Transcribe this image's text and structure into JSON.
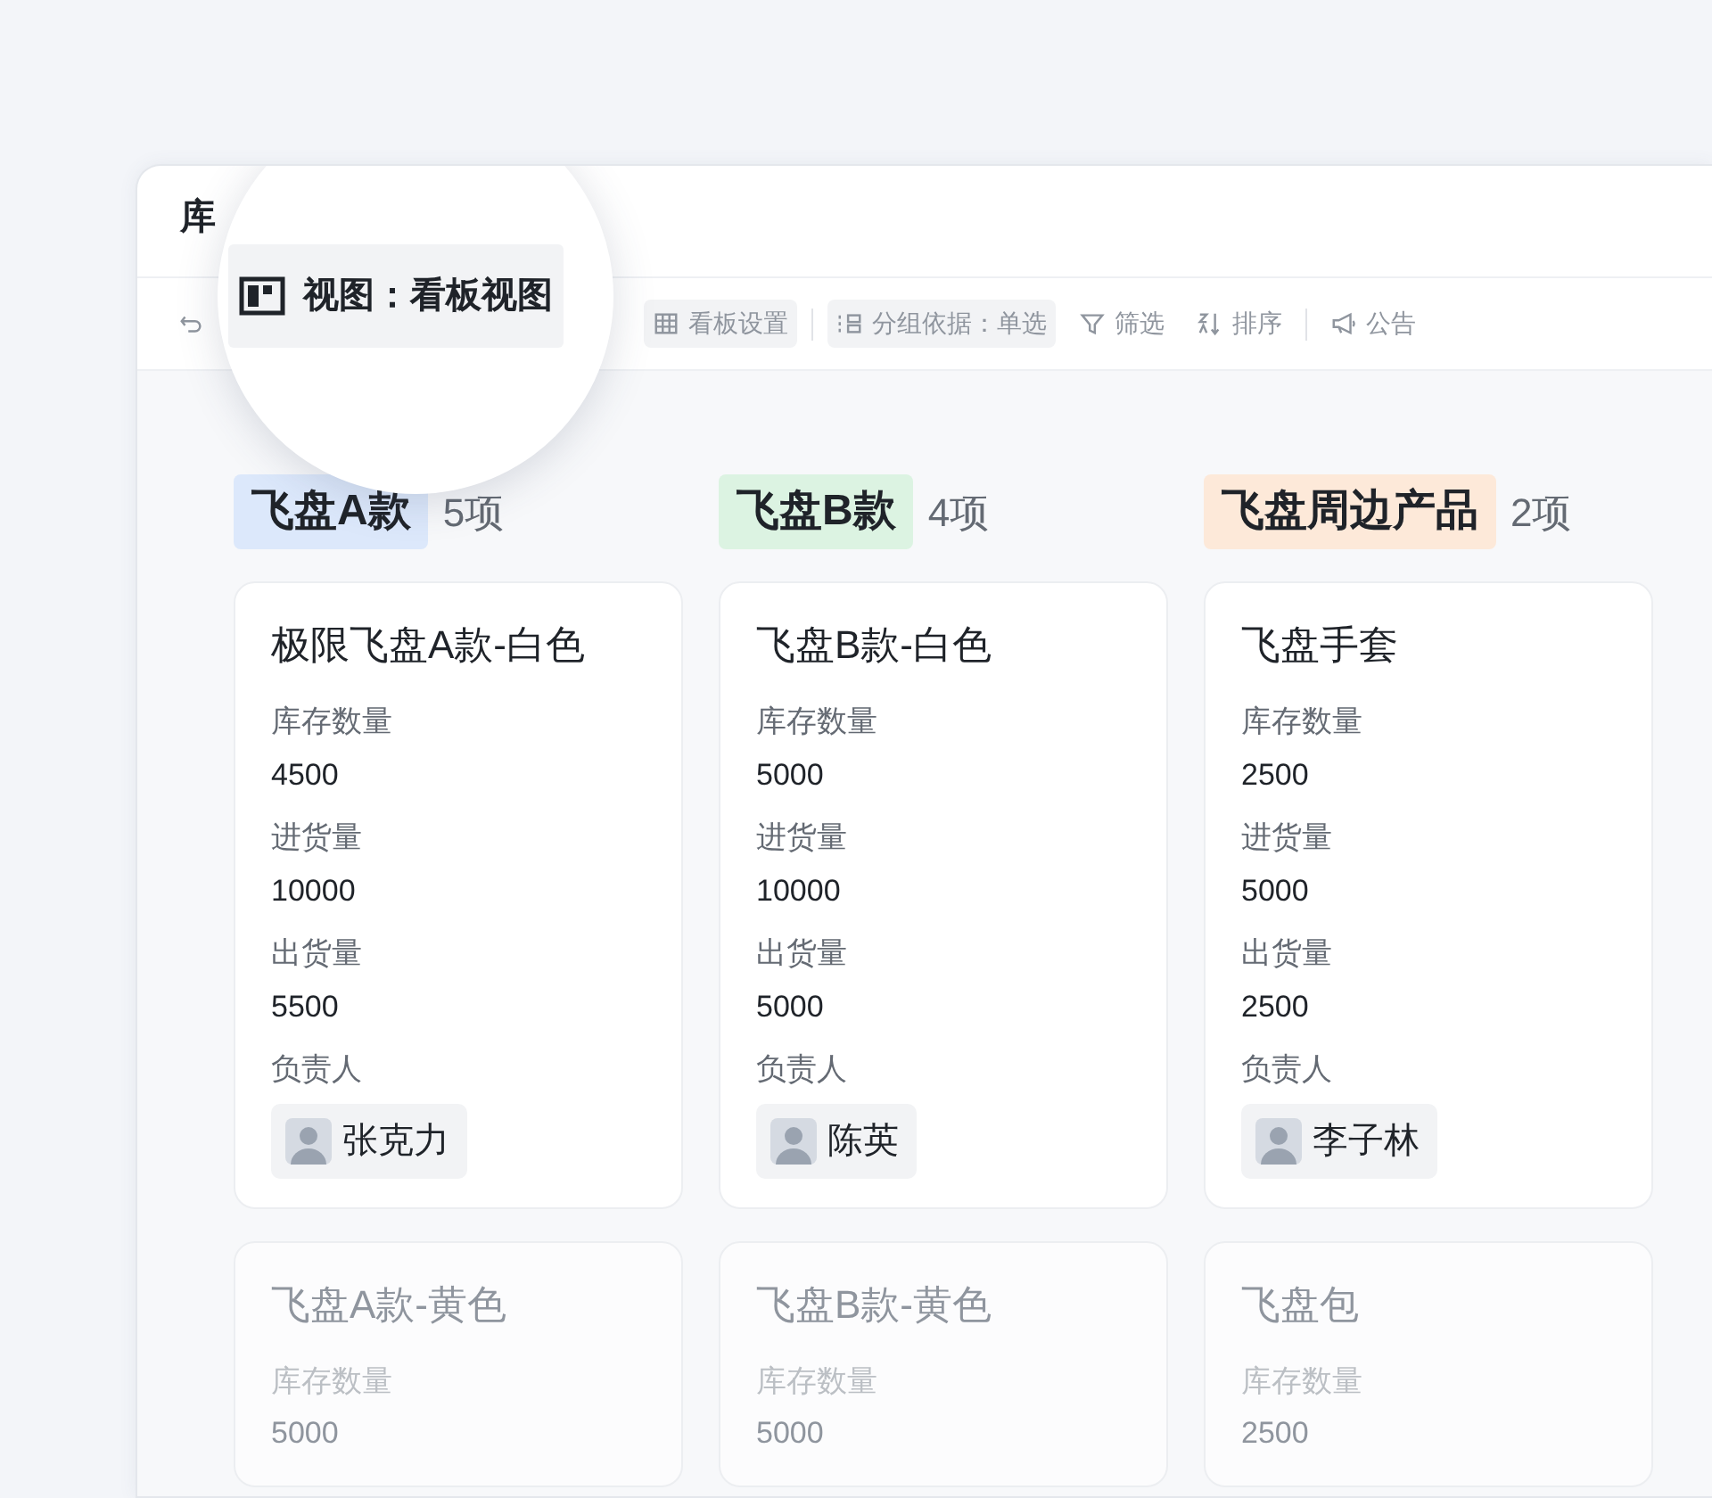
{
  "window": {
    "title": "库"
  },
  "toolbar": {
    "items": [
      {
        "kind": "undo"
      },
      {
        "kind": "hidden"
      },
      {
        "kind": "board-settings",
        "label": "看板设置",
        "highlighted": true
      },
      {
        "kind": "separator"
      },
      {
        "kind": "group-by",
        "label": "分组依据：单选",
        "highlighted": true
      },
      {
        "kind": "filter",
        "label": "筛选",
        "highlighted": false
      },
      {
        "kind": "sort",
        "label": "排序",
        "highlighted": false
      },
      {
        "kind": "separator"
      },
      {
        "kind": "notice",
        "label": "公告",
        "highlighted": false
      }
    ]
  },
  "magnifier": {
    "label": "视图：看板视图"
  },
  "columns": [
    {
      "name": "飞盘A款",
      "color": "#dce8fb",
      "count": "5项",
      "cards": [
        {
          "title": "极限飞盘A款-白色",
          "dimmed": false,
          "fields": [
            {
              "label": "库存数量",
              "value": "4500"
            },
            {
              "label": "进货量",
              "value": "10000"
            },
            {
              "label": "出货量",
              "value": "5500"
            }
          ],
          "owner_label": "负责人",
          "owner": "张克力"
        },
        {
          "title": "飞盘A款-黄色",
          "dimmed": true,
          "fields": [
            {
              "label": "库存数量",
              "value": "5000"
            }
          ]
        }
      ]
    },
    {
      "name": "飞盘B款",
      "color": "#dcf3e2",
      "count": "4项",
      "cards": [
        {
          "title": "飞盘B款-白色",
          "dimmed": false,
          "fields": [
            {
              "label": "库存数量",
              "value": "5000"
            },
            {
              "label": "进货量",
              "value": "10000"
            },
            {
              "label": "出货量",
              "value": "5000"
            }
          ],
          "owner_label": "负责人",
          "owner": "陈英"
        },
        {
          "title": "飞盘B款-黄色",
          "dimmed": true,
          "fields": [
            {
              "label": "库存数量",
              "value": "5000"
            }
          ]
        }
      ]
    },
    {
      "name": "飞盘周边产品",
      "color": "#fde9d9",
      "count": "2项",
      "cards": [
        {
          "title": "飞盘手套",
          "dimmed": false,
          "fields": [
            {
              "label": "库存数量",
              "value": "2500"
            },
            {
              "label": "进货量",
              "value": "5000"
            },
            {
              "label": "出货量",
              "value": "2500"
            }
          ],
          "owner_label": "负责人",
          "owner": "李子林"
        },
        {
          "title": "飞盘包",
          "dimmed": true,
          "fields": [
            {
              "label": "库存数量",
              "value": "2500"
            }
          ]
        }
      ]
    }
  ]
}
